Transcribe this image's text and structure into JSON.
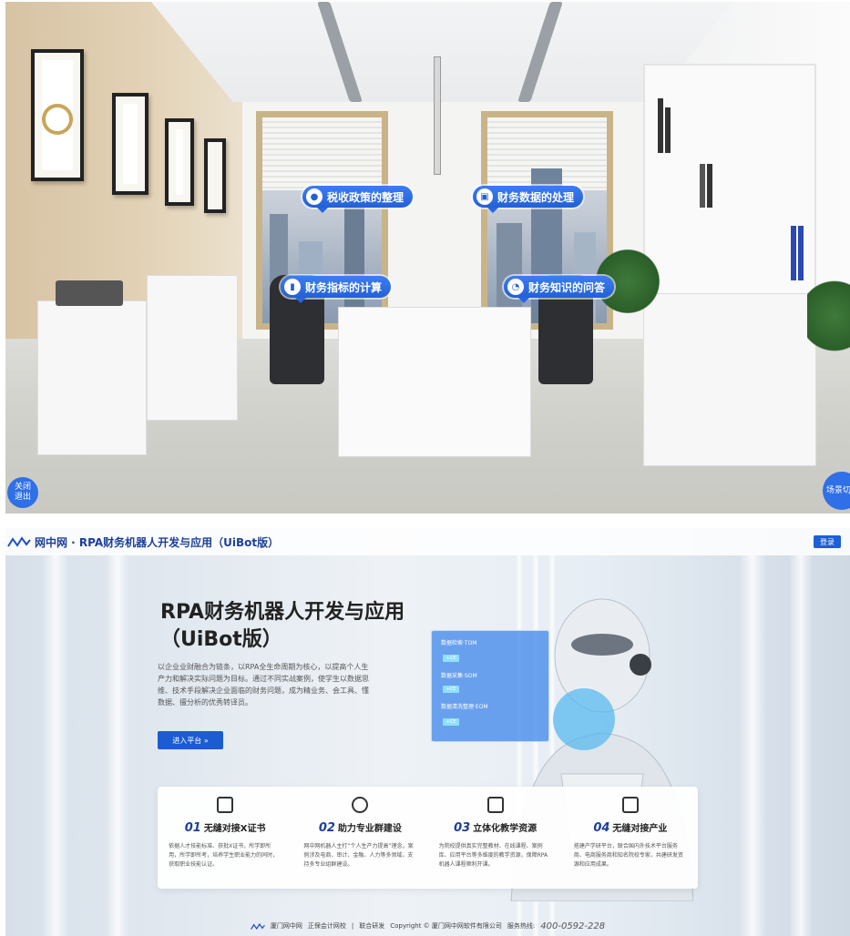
{
  "scene": {
    "hotspots": [
      {
        "label": "税收政策的整理",
        "icon": "pin-icon"
      },
      {
        "label": "财务数据的处理",
        "icon": "data-icon"
      },
      {
        "label": "财务指标的计算",
        "icon": "bar-chart-icon"
      },
      {
        "label": "财务知识的问答",
        "icon": "chat-icon"
      }
    ],
    "close_button": "关闭\n退出",
    "switch_button": "场景切换"
  },
  "site": {
    "brand": "网中网 · RPA财务机器人开发与应用（UiBot版）",
    "login_label": "登录",
    "hero_title_line1": "RPA财务机器人开发与应用",
    "hero_title_line2": "（UiBot版）",
    "hero_desc": "以企业业财融合为链条，以RPA全生命周期为核心，以提高个人生产力和解决实际问题为目标。通过不同实战案例，使学生以数据思维、技术手段解决企业面临的财务问题，成为精业务、会工具、懂数据、擅分析的优秀转译员。",
    "enter_button": "进入平台 »",
    "panel_rows": [
      "数据检索·TOM",
      "数据采集·SOM",
      "数据清洗整理·EOM"
    ],
    "panel_chip": "+CE",
    "features": [
      {
        "num": "01",
        "title": "无缝对接X证书",
        "desc": "依据人才技能标准、获批X证书，所学即所用，所学即所考，培养学生职业能力的同时，获取职业技能认证。",
        "icon": "certificate-icon"
      },
      {
        "num": "02",
        "title": "助力专业群建设",
        "desc": "网中网机器人主打“个人生产力提高”理念，案例涉及电商、审计、金融、人力等多领域，支持多专业组群建设。",
        "icon": "people-icon"
      },
      {
        "num": "03",
        "title": "立体化教学资源",
        "desc": "为院校提供真实完整教材、在线课程、案例库、应用平台等多维度的教学资源，保障RPA机器人课程顺利开课。",
        "icon": "resource-icon"
      },
      {
        "num": "04",
        "title": "无缝对接产业",
        "desc": "搭建产学研平台，联合国内外技术平台服务商、电商服务商和知名院校专家，共建研发资源和应用成果。",
        "icon": "industry-icon"
      }
    ],
    "footer": {
      "logo1": "厦门网中网",
      "logo2": "正保会计网校",
      "sep": "|",
      "coop": "联合研发",
      "copyright": "Copyright © 厦门网中网软件有限公司",
      "hotline_label": "服务热线:",
      "hotline": "400-0592-228"
    }
  }
}
